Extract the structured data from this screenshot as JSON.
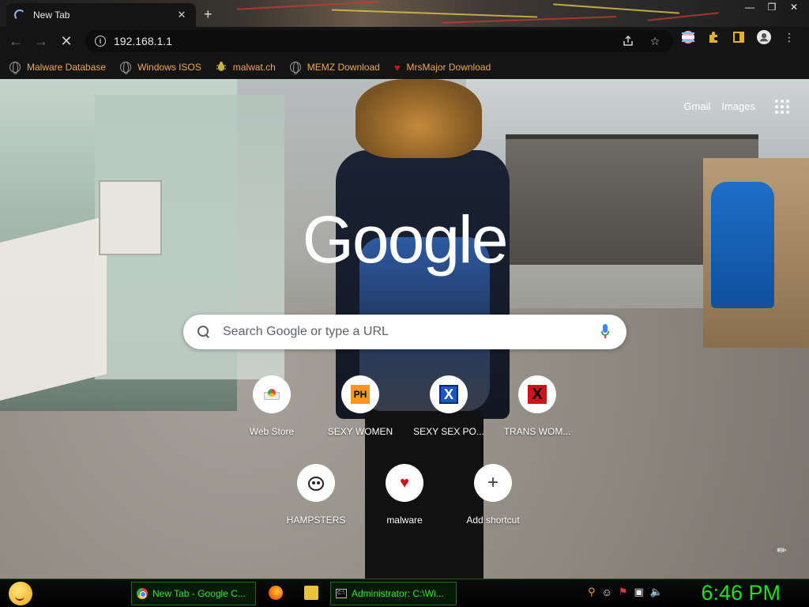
{
  "browser": {
    "tab": {
      "title": "New Tab",
      "close": "✕"
    },
    "new_tab": "+",
    "window_controls": {
      "minimize": "—",
      "maximize": "❐",
      "close": "✕"
    },
    "address": "192.168.1.1",
    "nav": {
      "back": "←",
      "forward": "→",
      "stop": "✕"
    }
  },
  "bookmarks": [
    {
      "label": "Malware Database",
      "icon": "globe-icon"
    },
    {
      "label": "Windows ISOS",
      "icon": "globe-icon"
    },
    {
      "label": "malwat.ch",
      "icon": "bug-icon"
    },
    {
      "label": "MEMZ Download",
      "icon": "globe-icon"
    },
    {
      "label": "MrsMajor Download",
      "icon": "heart-icon"
    }
  ],
  "ntp": {
    "links": {
      "gmail": "Gmail",
      "images": "Images"
    },
    "logo": "Google",
    "search_placeholder": "Search Google or type a URL",
    "shortcuts": [
      {
        "label": "Web Store",
        "icon": "chrome-web-store-icon"
      },
      {
        "label": "SEXY WOMEN",
        "icon": "ph-icon",
        "badge": "PH"
      },
      {
        "label": "SEXY SEX PO...",
        "icon": "blue-x-icon",
        "badge": "X"
      },
      {
        "label": "TRANS WOM...",
        "icon": "red-x-icon",
        "badge": "X"
      },
      {
        "label": "HAMPSTERS",
        "icon": "hamster-icon"
      },
      {
        "label": "malware",
        "icon": "heart-icon",
        "badge": "♥"
      },
      {
        "label": "Add shortcut",
        "icon": "plus-icon",
        "badge": "+"
      }
    ]
  },
  "taskbar": {
    "tasks": [
      {
        "label": "New Tab - Google C...",
        "icon": "chrome-icon"
      },
      {
        "label": "Administrator: C:\\Wi...",
        "icon": "cmd-icon"
      }
    ],
    "clock": "6:46 PM"
  },
  "colors": {
    "bookmark_text": "#f0a845",
    "taskbar_text": "#2ee62e",
    "clock": "#16e616"
  }
}
